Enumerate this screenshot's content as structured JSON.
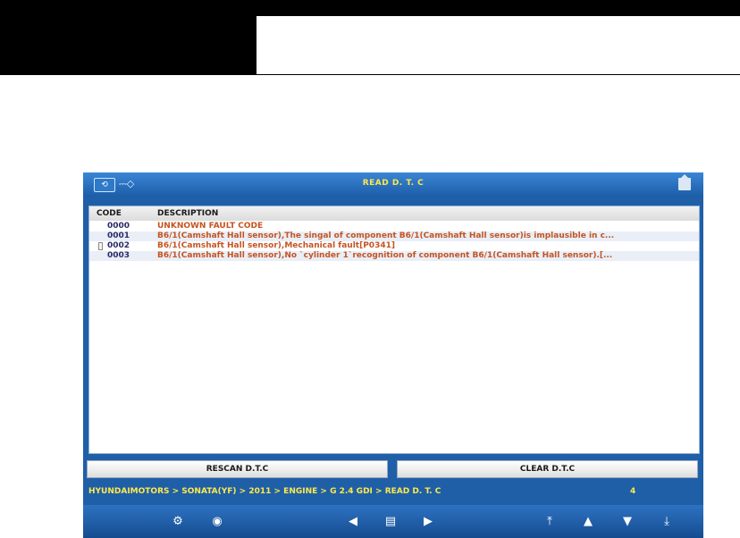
{
  "titlebar": {
    "title": "READ D. T. C",
    "left_icons": [
      "refresh-icon",
      "usb-icon"
    ],
    "right_icon": "home-icon"
  },
  "table": {
    "headers": {
      "code": "CODE",
      "description": "DESCRIPTION"
    },
    "rows": [
      {
        "code": "0000",
        "description": "UNKNOWN FAULT CODE"
      },
      {
        "code": "0001",
        "description": "B6/1(Camshaft Hall sensor),The singal of component B6/1(Camshaft Hall sensor)is implausible in c..."
      },
      {
        "code": "0002",
        "description": "B6/1(Camshaft Hall sensor),Mechanical fault[P0341]"
      },
      {
        "code": "0003",
        "description": "B6/1(Camshaft Hall sensor),No `cylinder 1`recognition of component B6/1(Camshaft Hall sensor).[..."
      }
    ]
  },
  "buttons": {
    "rescan": "RESCAN D.T.C",
    "clear": "CLEAR D.T.C"
  },
  "status": {
    "breadcrumb": "HYUNDAIMOTORS > SONATA(YF) > 2011 > ENGINE > G 2.4 GDI > READ D. T. C",
    "count": "4"
  },
  "toolbar_icons": [
    "settings-icon",
    "record-icon",
    "back-arrow-icon",
    "print-icon",
    "forward-arrow-icon",
    "page-top-icon",
    "page-up-icon",
    "page-down-icon",
    "page-bottom-icon"
  ],
  "colors": {
    "frame": "#1f5fa8",
    "title_text": "#ffe94a",
    "fault_text": "#c55420"
  }
}
